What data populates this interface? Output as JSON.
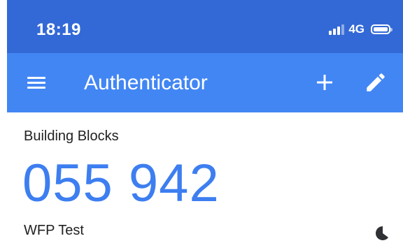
{
  "status_bar": {
    "time": "18:19",
    "network": "4G",
    "signal_bars": 3,
    "battery_icon": "battery-full-icon",
    "color": "#3369d6"
  },
  "app_bar": {
    "title": "Authenticator",
    "menu_icon": "menu-icon",
    "add_icon": "add-icon",
    "edit_icon": "edit-icon",
    "color": "#4286f4"
  },
  "account": {
    "issuer": "Building Blocks",
    "code": "055 942",
    "name": "WFP Test",
    "countdown_icon": "countdown-timer-icon",
    "code_color": "#3d7ef0"
  }
}
